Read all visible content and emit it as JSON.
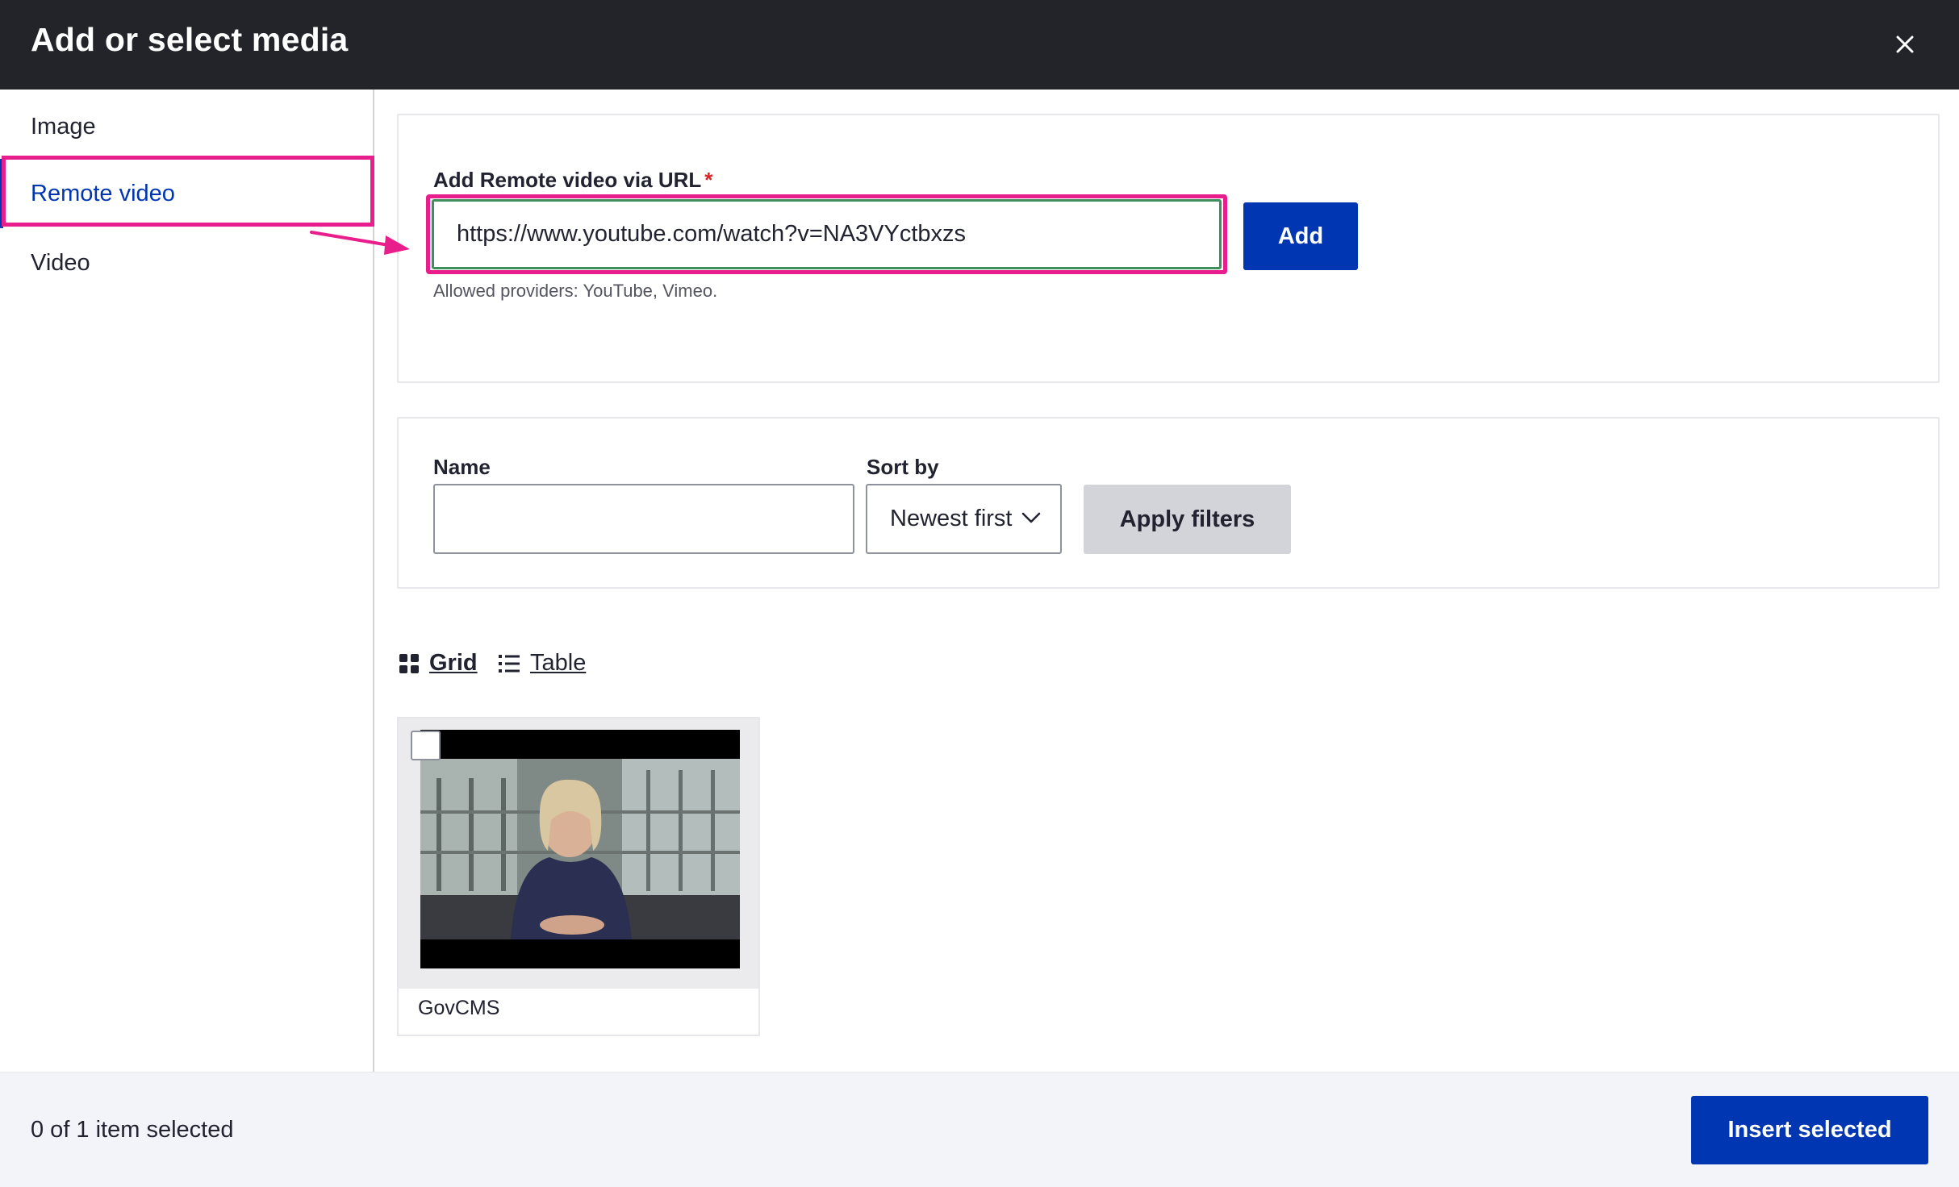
{
  "dialog": {
    "title": "Add or select media",
    "close_icon": "close-icon"
  },
  "sidebar": {
    "items": [
      {
        "label": "Image",
        "active": false
      },
      {
        "label": "Remote video",
        "active": true
      },
      {
        "label": "Video",
        "active": false
      }
    ]
  },
  "add_form": {
    "label": "Add Remote video via URL",
    "required_mark": "*",
    "url_value": "https://www.youtube.com/watch?v=NA3VYctbxzs",
    "add_button": "Add",
    "help_text": "Allowed providers: YouTube, Vimeo."
  },
  "filters": {
    "name_label": "Name",
    "name_value": "",
    "sort_label": "Sort by",
    "sort_selected": "Newest first",
    "apply_button": "Apply filters"
  },
  "view_switch": {
    "grid_label": "Grid",
    "grid_icon": "grid-icon",
    "table_label": "Table",
    "table_icon": "list-icon"
  },
  "media_items": [
    {
      "name": "GovCMS",
      "selected": false,
      "thumbnail": "video-thumbnail"
    }
  ],
  "footer": {
    "status": "0 of 1 item selected",
    "insert_button": "Insert selected"
  },
  "colors": {
    "primary": "#0036b1",
    "header_bg": "#232429",
    "annotation": "#e81e8c",
    "required": "#dc2323"
  }
}
